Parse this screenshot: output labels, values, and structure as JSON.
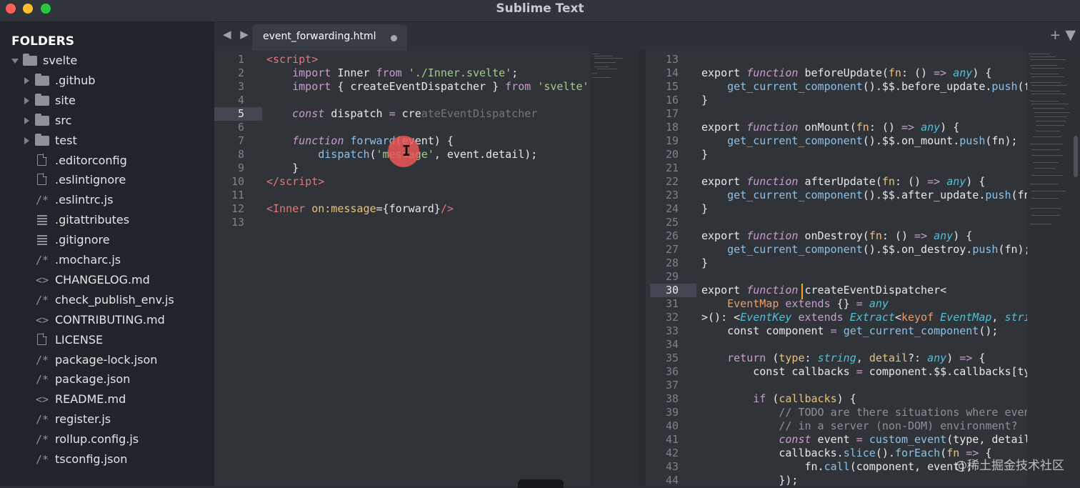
{
  "window": {
    "title": "Sublime Text"
  },
  "sidebar": {
    "header": "FOLDERS",
    "items": [
      {
        "label": "svelte",
        "icon": "folder-icon",
        "expanded": true,
        "depth": 0
      },
      {
        "label": ".github",
        "icon": "folder-icon",
        "expanded": false,
        "depth": 1
      },
      {
        "label": "site",
        "icon": "folder-icon",
        "expanded": false,
        "depth": 1
      },
      {
        "label": "src",
        "icon": "folder-icon",
        "expanded": false,
        "depth": 1
      },
      {
        "label": "test",
        "icon": "folder-icon",
        "expanded": false,
        "depth": 1
      },
      {
        "label": ".editorconfig",
        "icon": "file-icon",
        "depth": 1
      },
      {
        "label": ".eslintignore",
        "icon": "file-icon",
        "depth": 1
      },
      {
        "label": ".eslintrc.js",
        "icon": "js-comment-icon",
        "depth": 1
      },
      {
        "label": ".gitattributes",
        "icon": "lines-file-icon",
        "depth": 1
      },
      {
        "label": ".gitignore",
        "icon": "lines-file-icon",
        "depth": 1
      },
      {
        "label": ".mocharc.js",
        "icon": "js-comment-icon",
        "depth": 1
      },
      {
        "label": "CHANGELOG.md",
        "icon": "markup-icon",
        "depth": 1
      },
      {
        "label": "check_publish_env.js",
        "icon": "js-comment-icon",
        "depth": 1
      },
      {
        "label": "CONTRIBUTING.md",
        "icon": "markup-icon",
        "depth": 1
      },
      {
        "label": "LICENSE",
        "icon": "file-icon",
        "depth": 1
      },
      {
        "label": "package-lock.json",
        "icon": "js-comment-icon",
        "depth": 1
      },
      {
        "label": "package.json",
        "icon": "js-comment-icon",
        "depth": 1
      },
      {
        "label": "README.md",
        "icon": "markup-icon",
        "depth": 1
      },
      {
        "label": "register.js",
        "icon": "js-comment-icon",
        "depth": 1
      },
      {
        "label": "rollup.config.js",
        "icon": "js-comment-icon",
        "depth": 1
      },
      {
        "label": "tsconfig.json",
        "icon": "js-comment-icon",
        "depth": 1
      }
    ]
  },
  "tabs": [
    {
      "label": "event_forwarding.html",
      "dirty": true,
      "active": true
    }
  ],
  "tab_nav": "◀ ▶",
  "tab_actions": "+ ▼",
  "left_editor": {
    "active_line": 5,
    "lines": [
      {
        "n": "1",
        "tokens": [
          [
            "tag",
            "<script"
          ],
          [
            "tag",
            ">"
          ]
        ]
      },
      {
        "n": "2",
        "tokens": [
          [
            "white",
            "    "
          ],
          [
            "kw",
            "import"
          ],
          [
            "white",
            " Inner "
          ],
          [
            "kw",
            "from"
          ],
          [
            "white",
            " "
          ],
          [
            "str",
            "'./Inner.svelte'"
          ],
          [
            "white",
            ";"
          ]
        ]
      },
      {
        "n": "3",
        "tokens": [
          [
            "white",
            "    "
          ],
          [
            "kw",
            "import"
          ],
          [
            "white",
            " { createEventDispatcher } "
          ],
          [
            "kw",
            "from"
          ],
          [
            "white",
            " "
          ],
          [
            "str",
            "'svelte'"
          ],
          [
            "white",
            ";"
          ]
        ]
      },
      {
        "n": "4",
        "tokens": []
      },
      {
        "n": "5",
        "tokens": [
          [
            "white",
            "    "
          ],
          [
            "kwi",
            "const"
          ],
          [
            "white",
            " dispatch "
          ],
          [
            "kw",
            "="
          ],
          [
            "white",
            " cre"
          ],
          [
            "ghost",
            "ateEventDispatcher"
          ]
        ]
      },
      {
        "n": "6",
        "tokens": []
      },
      {
        "n": "7",
        "tokens": [
          [
            "white",
            "    "
          ],
          [
            "kwi",
            "function"
          ],
          [
            "white",
            " "
          ],
          [
            "fn",
            "forward"
          ],
          [
            "white",
            "(event) {"
          ]
        ]
      },
      {
        "n": "8",
        "tokens": [
          [
            "white",
            "        "
          ],
          [
            "fn",
            "dispatch"
          ],
          [
            "white",
            "("
          ],
          [
            "str",
            "'message'"
          ],
          [
            "white",
            ", event.detail);"
          ]
        ]
      },
      {
        "n": "9",
        "tokens": [
          [
            "white",
            "    }"
          ]
        ]
      },
      {
        "n": "10",
        "tokens": [
          [
            "tag",
            "</script"
          ],
          [
            "tag",
            ">"
          ]
        ]
      },
      {
        "n": "11",
        "tokens": []
      },
      {
        "n": "12",
        "tokens": [
          [
            "tag",
            "<Inner"
          ],
          [
            "white",
            " "
          ],
          [
            "attr",
            "on:message"
          ],
          [
            "white",
            "={forward}"
          ],
          [
            "tag",
            "/>"
          ]
        ]
      },
      {
        "n": "13",
        "tokens": []
      }
    ]
  },
  "right_editor": {
    "active_line": 30,
    "lines": [
      {
        "n": "13",
        "tokens": []
      },
      {
        "n": "14",
        "tokens": [
          [
            "white",
            "export "
          ],
          [
            "kwi",
            "function"
          ],
          [
            "white",
            " beforeUpdate("
          ],
          [
            "attr",
            "fn"
          ],
          [
            "white",
            ": () "
          ],
          [
            "kw",
            "=>"
          ],
          [
            "white",
            " "
          ],
          [
            "typ",
            "any"
          ],
          [
            "white",
            ") {"
          ]
        ]
      },
      {
        "n": "15",
        "tokens": [
          [
            "white",
            "    "
          ],
          [
            "fn",
            "get_current_component"
          ],
          [
            "white",
            "().$$.before_update."
          ],
          [
            "fn",
            "push"
          ],
          [
            "white",
            "(fn);"
          ]
        ]
      },
      {
        "n": "16",
        "tokens": [
          [
            "white",
            "}"
          ]
        ]
      },
      {
        "n": "17",
        "tokens": []
      },
      {
        "n": "18",
        "tokens": [
          [
            "white",
            "export "
          ],
          [
            "kwi",
            "function"
          ],
          [
            "white",
            " onMount("
          ],
          [
            "attr",
            "fn"
          ],
          [
            "white",
            ": () "
          ],
          [
            "kw",
            "=>"
          ],
          [
            "white",
            " "
          ],
          [
            "typ",
            "any"
          ],
          [
            "white",
            ") {"
          ]
        ]
      },
      {
        "n": "19",
        "tokens": [
          [
            "white",
            "    "
          ],
          [
            "fn",
            "get_current_component"
          ],
          [
            "white",
            "().$$.on_mount."
          ],
          [
            "fn",
            "push"
          ],
          [
            "white",
            "(fn);"
          ]
        ]
      },
      {
        "n": "20",
        "tokens": [
          [
            "white",
            "}"
          ]
        ]
      },
      {
        "n": "21",
        "tokens": []
      },
      {
        "n": "22",
        "tokens": [
          [
            "white",
            "export "
          ],
          [
            "kwi",
            "function"
          ],
          [
            "white",
            " afterUpdate("
          ],
          [
            "attr",
            "fn"
          ],
          [
            "white",
            ": () "
          ],
          [
            "kw",
            "=>"
          ],
          [
            "white",
            " "
          ],
          [
            "typ",
            "any"
          ],
          [
            "white",
            ") {"
          ]
        ]
      },
      {
        "n": "23",
        "tokens": [
          [
            "white",
            "    "
          ],
          [
            "fn",
            "get_current_component"
          ],
          [
            "white",
            "().$$.after_update."
          ],
          [
            "fn",
            "push"
          ],
          [
            "white",
            "(fn);"
          ]
        ]
      },
      {
        "n": "24",
        "tokens": [
          [
            "white",
            "}"
          ]
        ]
      },
      {
        "n": "25",
        "tokens": []
      },
      {
        "n": "26",
        "tokens": [
          [
            "white",
            "export "
          ],
          [
            "kwi",
            "function"
          ],
          [
            "white",
            " onDestroy("
          ],
          [
            "attr",
            "fn"
          ],
          [
            "white",
            ": () "
          ],
          [
            "kw",
            "=>"
          ],
          [
            "white",
            " "
          ],
          [
            "typ",
            "any"
          ],
          [
            "white",
            ") {"
          ]
        ]
      },
      {
        "n": "27",
        "tokens": [
          [
            "white",
            "    "
          ],
          [
            "fn",
            "get_current_component"
          ],
          [
            "white",
            "().$$.on_destroy."
          ],
          [
            "fn",
            "push"
          ],
          [
            "white",
            "(fn);"
          ]
        ]
      },
      {
        "n": "28",
        "tokens": [
          [
            "white",
            "}"
          ]
        ]
      },
      {
        "n": "29",
        "tokens": []
      },
      {
        "n": "30",
        "tokens": [
          [
            "white",
            "export "
          ],
          [
            "kwi",
            "function"
          ],
          [
            "white",
            " createEventDispatcher<"
          ]
        ]
      },
      {
        "n": "31",
        "tokens": [
          [
            "white",
            "    "
          ],
          [
            "orange",
            "EventMap"
          ],
          [
            "white",
            " "
          ],
          [
            "kw",
            "extends"
          ],
          [
            "white",
            " {} "
          ],
          [
            "kw",
            "="
          ],
          [
            "white",
            " "
          ],
          [
            "typ",
            "any"
          ]
        ]
      },
      {
        "n": "32",
        "tokens": [
          [
            "white",
            ">(): <"
          ],
          [
            "typ",
            "EventKey"
          ],
          [
            "white",
            " "
          ],
          [
            "kw",
            "extends"
          ],
          [
            "white",
            " "
          ],
          [
            "typ",
            "Extract"
          ],
          [
            "white",
            "<"
          ],
          [
            "orange",
            "keyof"
          ],
          [
            "white",
            " "
          ],
          [
            "typ",
            "EventMap"
          ],
          [
            "white",
            ", "
          ],
          [
            "typ",
            "string"
          ],
          [
            "white",
            ">"
          ]
        ]
      },
      {
        "n": "33",
        "tokens": [
          [
            "white",
            "    const component "
          ],
          [
            "kw",
            "="
          ],
          [
            "white",
            " "
          ],
          [
            "fn",
            "get_current_component"
          ],
          [
            "white",
            "();"
          ]
        ]
      },
      {
        "n": "34",
        "tokens": []
      },
      {
        "n": "35",
        "tokens": [
          [
            "white",
            "    "
          ],
          [
            "kw",
            "return"
          ],
          [
            "white",
            " ("
          ],
          [
            "attr",
            "type"
          ],
          [
            "white",
            ": "
          ],
          [
            "typ",
            "string"
          ],
          [
            "white",
            ", "
          ],
          [
            "attr",
            "detail"
          ],
          [
            "white",
            "?: "
          ],
          [
            "typ",
            "any"
          ],
          [
            "white",
            ") "
          ],
          [
            "kw",
            "=>"
          ],
          [
            "white",
            " {"
          ]
        ]
      },
      {
        "n": "36",
        "tokens": [
          [
            "white",
            "        const callbacks "
          ],
          [
            "kw",
            "="
          ],
          [
            "white",
            " component.$$.callbacks[type];"
          ]
        ]
      },
      {
        "n": "37",
        "tokens": []
      },
      {
        "n": "38",
        "tokens": [
          [
            "white",
            "        "
          ],
          [
            "kw",
            "if"
          ],
          [
            "white",
            " ("
          ],
          [
            "attr",
            "callbacks"
          ],
          [
            "white",
            ") {"
          ]
        ]
      },
      {
        "n": "39",
        "tokens": [
          [
            "comment",
            "            // TODO are there situations where events"
          ]
        ]
      },
      {
        "n": "40",
        "tokens": [
          [
            "comment",
            "            // in a server (non-DOM) environment?"
          ]
        ]
      },
      {
        "n": "41",
        "tokens": [
          [
            "white",
            "            "
          ],
          [
            "kwi",
            "const"
          ],
          [
            "white",
            " event "
          ],
          [
            "kw",
            "="
          ],
          [
            "white",
            " "
          ],
          [
            "fn",
            "custom_event"
          ],
          [
            "white",
            "(type, detail);"
          ]
        ]
      },
      {
        "n": "42",
        "tokens": [
          [
            "white",
            "            callbacks."
          ],
          [
            "fn",
            "slice"
          ],
          [
            "white",
            "()."
          ],
          [
            "fn",
            "forEach"
          ],
          [
            "white",
            "("
          ],
          [
            "attr",
            "fn"
          ],
          [
            "white",
            " "
          ],
          [
            "kw",
            "=>"
          ],
          [
            "white",
            " {"
          ]
        ]
      },
      {
        "n": "43",
        "tokens": [
          [
            "white",
            "                fn."
          ],
          [
            "fn",
            "call"
          ],
          [
            "white",
            "(component, event);"
          ]
        ]
      },
      {
        "n": "44",
        "tokens": [
          [
            "white",
            "            });"
          ]
        ]
      }
    ]
  },
  "watermark": "@稀土掘金技术社区",
  "colors": {
    "accent_caret": "#f5a623",
    "cursor_highlight": "#eb5757"
  }
}
